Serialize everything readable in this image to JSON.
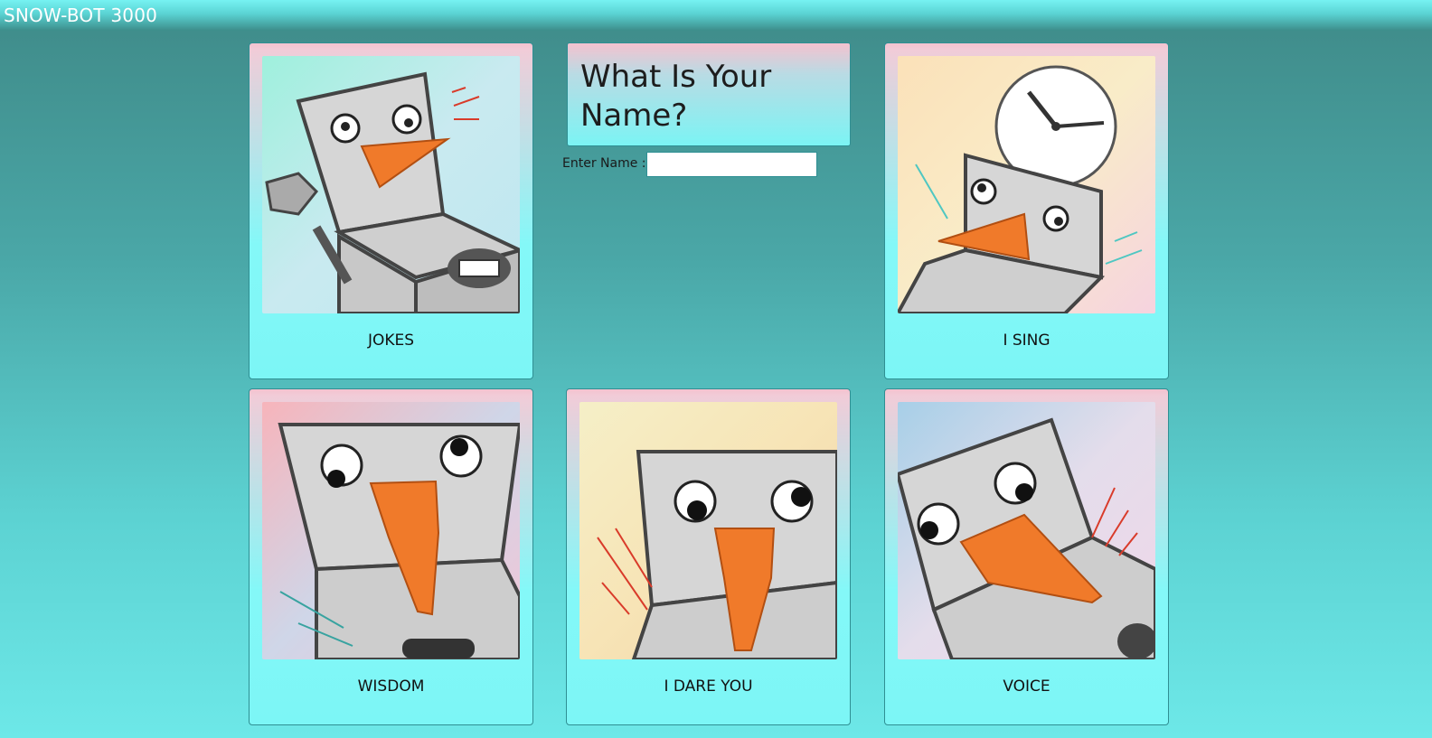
{
  "app": {
    "title": "SNOW-BOT 3000"
  },
  "prompt": {
    "title": "What Is Your Name?",
    "name_label": "Enter Name :",
    "name_value": "",
    "name_placeholder": ""
  },
  "cards": {
    "jokes": {
      "label": "JOKES",
      "image_icon": "snowbot-laptop-waving-icon"
    },
    "sing": {
      "label": "I SING",
      "image_icon": "snowbot-clock-icon"
    },
    "wisdom": {
      "label": "WISDOM",
      "image_icon": "snowbot-closeup-icon"
    },
    "dare": {
      "label": "I DARE YOU",
      "image_icon": "snowbot-surprised-icon"
    },
    "voice": {
      "label": "VOICE",
      "image_icon": "snowbot-tilted-icon"
    }
  },
  "colors": {
    "accent": "#7cf6f6",
    "card_top": "#f4c2cf",
    "carrot": "#f07a2a",
    "page_bg_dark": "#3f8a88"
  }
}
